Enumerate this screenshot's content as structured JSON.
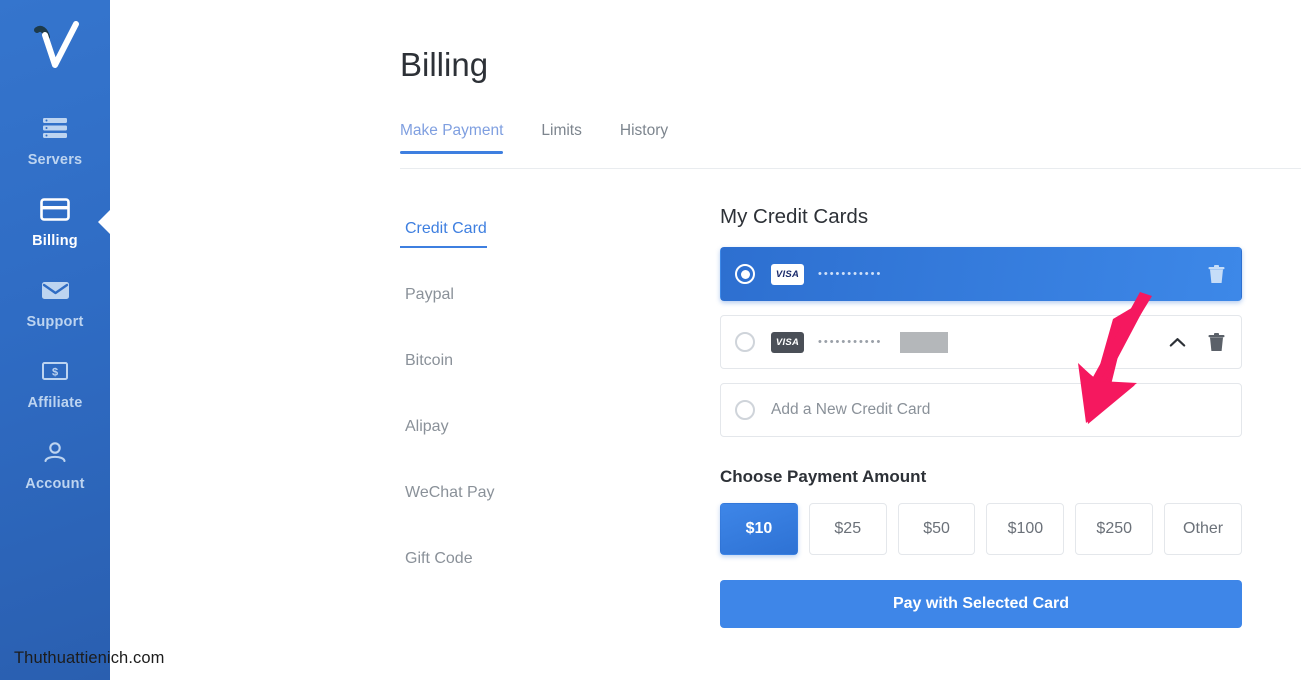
{
  "brand": {
    "logo_icon": "checkmark-logo",
    "accent_color": "#3e86e8",
    "sidebar_color": "#2f6cc4"
  },
  "sidebar": {
    "items": [
      {
        "label": "Servers",
        "icon": "servers-icon",
        "active": false
      },
      {
        "label": "Billing",
        "icon": "credit-card-icon",
        "active": true
      },
      {
        "label": "Support",
        "icon": "envelope-icon",
        "active": false
      },
      {
        "label": "Affiliate",
        "icon": "dollar-bill-icon",
        "active": false
      },
      {
        "label": "Account",
        "icon": "person-icon",
        "active": false
      }
    ]
  },
  "watermark": "Thuthuattienich.com",
  "header": {
    "title": "Billing"
  },
  "tabs": [
    {
      "label": "Make Payment",
      "active": true
    },
    {
      "label": "Limits",
      "active": false
    },
    {
      "label": "History",
      "active": false
    }
  ],
  "payment_methods": [
    {
      "label": "Credit Card",
      "active": true
    },
    {
      "label": "Paypal",
      "active": false
    },
    {
      "label": "Bitcoin",
      "active": false
    },
    {
      "label": "Alipay",
      "active": false
    },
    {
      "label": "WeChat Pay",
      "active": false
    },
    {
      "label": "Gift Code",
      "active": false
    }
  ],
  "cards_section": {
    "title": "My Credit Cards",
    "cards": [
      {
        "brand": "VISA",
        "mask": "•••••••••••",
        "selected": true,
        "has_chevron": false,
        "has_censor": false,
        "delete_icon": "trash-icon"
      },
      {
        "brand": "VISA",
        "mask": "•••••••••••",
        "selected": false,
        "has_chevron": true,
        "has_censor": true,
        "chevron_icon": "chevron-up-icon",
        "delete_icon": "trash-icon"
      }
    ],
    "add_new": {
      "label": "Add a New Credit Card",
      "selected": false
    }
  },
  "amount_section": {
    "title": "Choose Payment Amount",
    "options": [
      {
        "label": "$10",
        "selected": true
      },
      {
        "label": "$25",
        "selected": false
      },
      {
        "label": "$50",
        "selected": false
      },
      {
        "label": "$100",
        "selected": false
      },
      {
        "label": "$250",
        "selected": false
      },
      {
        "label": "Other",
        "selected": false
      }
    ]
  },
  "pay_button": {
    "label": "Pay with Selected Card"
  },
  "annotation": {
    "type": "arrow",
    "color": "#f5185f",
    "points_to": "Add a New Credit Card"
  }
}
